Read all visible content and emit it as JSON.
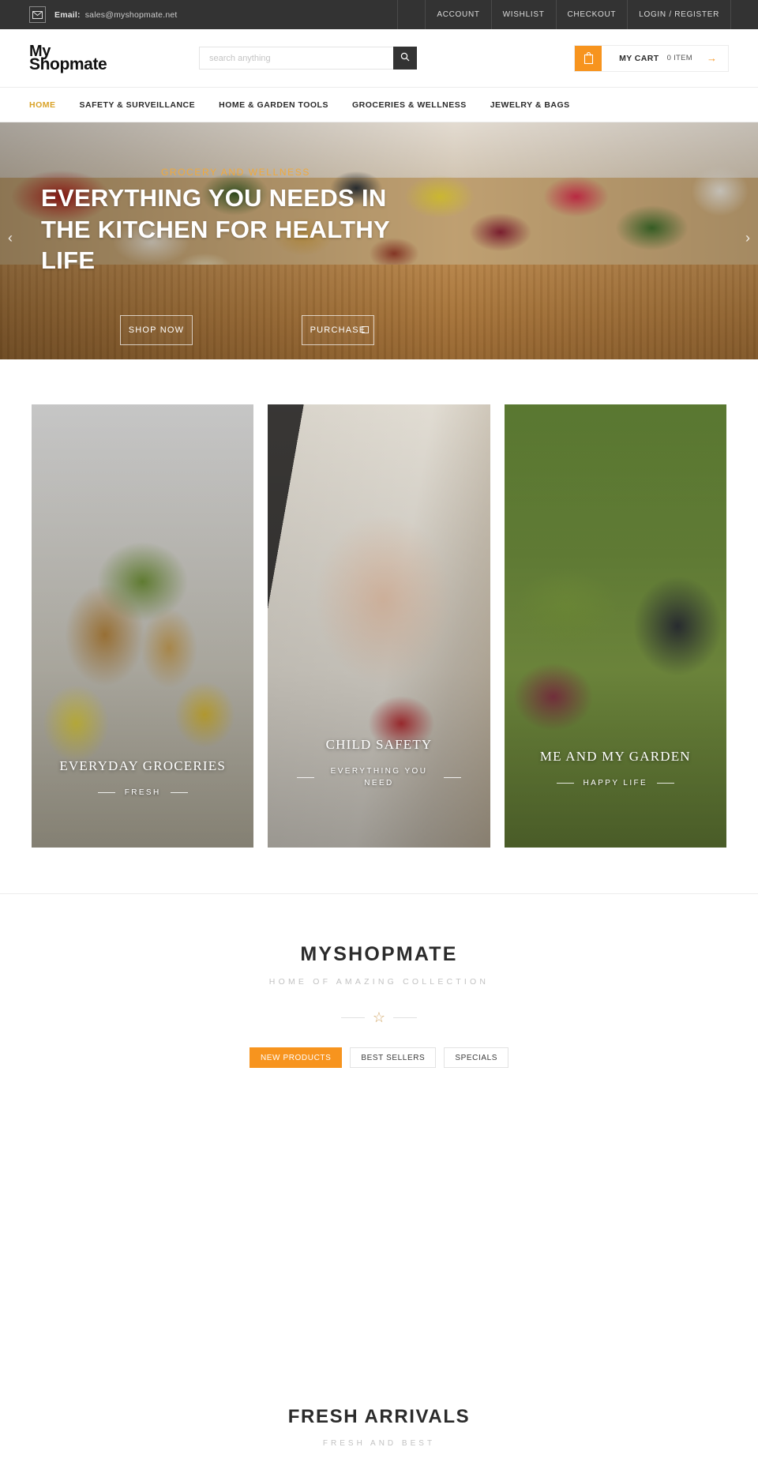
{
  "topbar": {
    "email_icon": "mail-icon",
    "email_label": "Email:",
    "email_value": "sales@myshopmate.net",
    "links": [
      {
        "label": "ACCOUNT"
      },
      {
        "label": "WISHLIST"
      },
      {
        "label": "CHECKOUT"
      },
      {
        "label": "LOGIN / REGISTER"
      }
    ]
  },
  "header": {
    "logo_line1": "My",
    "logo_line2": "Shopmate",
    "search_placeholder": "search anything",
    "search_value": "",
    "search_icon": "search-icon",
    "cart_icon": "shopping-bag-icon",
    "cart_label": "MY CART",
    "cart_count": "0 ITEM",
    "cart_arrow": "→"
  },
  "nav": {
    "items": [
      {
        "label": "HOME",
        "active": true
      },
      {
        "label": "SAFETY & SURVEILLANCE",
        "active": false
      },
      {
        "label": "HOME & GARDEN TOOLS",
        "active": false
      },
      {
        "label": "GROCERIES & WELLNESS",
        "active": false
      },
      {
        "label": "JEWELRY & BAGS",
        "active": false
      }
    ]
  },
  "hero": {
    "eyebrow": "GROCERY AND WELLNESS",
    "title": "EVERYTHING YOU NEEDS IN THE KITCHEN FOR HEALTHY LIFE",
    "btn_primary": "SHOP NOW",
    "btn_secondary": "PURCHASE",
    "arrow_left": "‹",
    "arrow_right": "›"
  },
  "cards": [
    {
      "title": "EVERYDAY GROCERIES",
      "subtitle": "FRESH"
    },
    {
      "title": "CHILD SAFETY",
      "subtitle": "EVERYTHING YOU NEED"
    },
    {
      "title": "ME AND MY GARDEN",
      "subtitle": "HAPPY LIFE"
    }
  ],
  "brand": {
    "title": "MYSHOPMATE",
    "subtitle": "HOME OF AMAZING COLLECTION",
    "star_icon": "star-icon",
    "tabs": [
      {
        "label": "NEW PRODUCTS",
        "active": true
      },
      {
        "label": "BEST SELLERS",
        "active": false
      },
      {
        "label": "SPECIALS",
        "active": false
      }
    ]
  },
  "fresh": {
    "title": "FRESH ARRIVALS",
    "subtitle": "FRESH AND BEST"
  },
  "colors": {
    "accent_orange": "#f7941e",
    "nav_active": "#d9a227",
    "topbar_bg": "#333333",
    "star_gold": "#d2a86a"
  }
}
